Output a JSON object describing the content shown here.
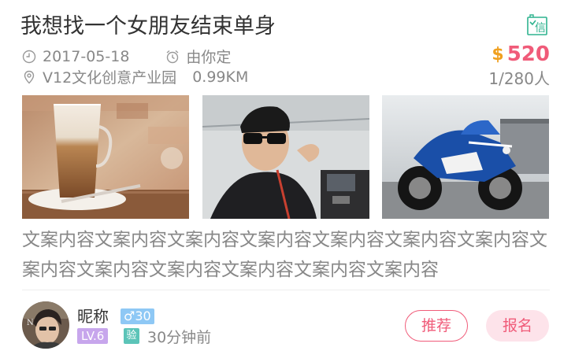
{
  "post": {
    "title": "我想找一个女朋友结束单身",
    "date": "2017-05-18",
    "payer": "由你定",
    "location": "V12文化创意产业园",
    "distance": "0.99KM",
    "price": "520",
    "currency_symbol": "$",
    "quota": "1/280人",
    "verify_icon_text": "信",
    "description": "文案内容文案内容文案内容文案内容文案内容文案内容文案内容文案内容文案内容文案内容文案内容文案内容文案内容"
  },
  "photos": [
    {
      "name": "latte-photo"
    },
    {
      "name": "man-in-car-photo"
    },
    {
      "name": "motorcycle-photo"
    }
  ],
  "user": {
    "nickname": "昵称",
    "gender_symbol": "♂",
    "age": "30",
    "level": "LV.6",
    "verified_label": "验",
    "time_ago": "30分钟前"
  },
  "actions": {
    "recommend_label": "推荐",
    "signup_label": "报名"
  },
  "colors": {
    "accent": "#f05b79",
    "gold": "#f0a020",
    "male_badge": "#8ec8f5",
    "level_badge": "#c7a6ec",
    "verify_badge": "#5cc4b8",
    "verify_icon": "#2fb38f"
  },
  "icons": {
    "date": "clock-icon",
    "payer": "alarm-icon",
    "location": "location-pin-icon",
    "verify": "certificate-icon",
    "price": "dollar-icon"
  }
}
